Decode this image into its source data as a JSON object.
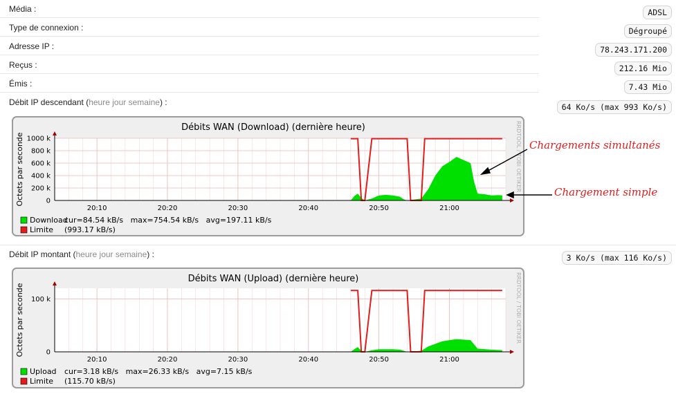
{
  "info": {
    "media_label": "Média :",
    "media_value": "ADSL",
    "type_label": "Type de connexion :",
    "type_value": "Dégroupé",
    "ip_label": "Adresse IP :",
    "ip_value": "78.243.171.200",
    "recus_label": "Reçus :",
    "recus_value": "212.16 Mio",
    "emis_label": "Émis :",
    "emis_value": "7.43 Mio"
  },
  "down": {
    "label_pre": "Débit IP descendant (",
    "link_heure": "heure",
    "link_jour": "jour",
    "link_semaine": "semaine",
    "label_post": ") :",
    "value": "64 Ko/s (max 993 Ko/s)"
  },
  "up": {
    "label_pre": "Débit IP montant (",
    "link_heure": "heure",
    "link_jour": "jour",
    "link_semaine": "semaine",
    "label_post": ") :",
    "value": "3 Ko/s (max 116 Ko/s)"
  },
  "annotations": {
    "simultanes": "Chargements simultanés",
    "simple": "Chargement simple"
  },
  "chart_data": [
    {
      "type": "area",
      "title": "Débits WAN (Download)  (dernière heure)",
      "ylabel": "Octets par seconde",
      "watermark": "RRDTOOL / TOBI OETIKER",
      "x_ticks": [
        "20:10",
        "20:20",
        "20:30",
        "20:40",
        "20:50",
        "21:00"
      ],
      "y_ticks": [
        "1000 k",
        "800 k",
        "600 k",
        "400 k",
        "200 k",
        "0"
      ],
      "ylim": [
        0,
        1000000
      ],
      "series": [
        {
          "name": "Download",
          "color": "#00e000",
          "legend_stats": "cur=84.54 kB/s   max=754.54 kB/s   avg=197.11 kB/s",
          "x": [
            "20:46",
            "20:46:30",
            "20:47",
            "20:47:30",
            "20:48",
            "20:49",
            "20:50",
            "20:51",
            "20:52",
            "20:53",
            "20:53:30",
            "20:54",
            "20:56",
            "20:57",
            "20:58",
            "20:59",
            "21:00",
            "21:01",
            "21:02",
            "21:03",
            "21:03:30",
            "21:04",
            "21:05",
            "21:06",
            "21:07",
            "21:07:30"
          ],
          "values": [
            0,
            70000,
            110000,
            40000,
            0,
            30000,
            80000,
            90000,
            80000,
            60000,
            20000,
            0,
            30000,
            180000,
            400000,
            550000,
            620000,
            700000,
            650000,
            600000,
            300000,
            110000,
            100000,
            80000,
            85000,
            80000
          ]
        },
        {
          "name": "Limite",
          "color": "#e31b1b",
          "legend_stats": "(993.17 kB/s)",
          "x": [
            "20:46",
            "20:47",
            "20:47:30",
            "20:48",
            "20:49",
            "20:49:30",
            "20:54",
            "20:54:30",
            "20:56",
            "20:56:30",
            "21:07:30"
          ],
          "values": [
            993170,
            993170,
            0,
            0,
            993170,
            993170,
            993170,
            0,
            0,
            993170,
            993170
          ]
        }
      ]
    },
    {
      "type": "area",
      "title": "Débits WAN (Upload)  (dernière heure)",
      "ylabel": "Octets par seconde",
      "watermark": "RRDTOOL / TOBI OETIKER",
      "x_ticks": [
        "20:10",
        "20:20",
        "20:30",
        "20:40",
        "20:50",
        "21:00"
      ],
      "y_ticks": [
        "100 k",
        "0"
      ],
      "ylim": [
        0,
        120000
      ],
      "series": [
        {
          "name": "Upload",
          "color": "#00e000",
          "legend_stats": "cur=3.18 kB/s   max=26.33 kB/s   avg=7.15 kB/s",
          "x": [
            "20:46",
            "20:46:30",
            "20:47",
            "20:47:30",
            "20:48",
            "20:49",
            "20:50",
            "20:52",
            "20:53",
            "20:54",
            "20:56",
            "20:57",
            "20:58",
            "20:59",
            "21:00",
            "21:01",
            "21:02",
            "21:03",
            "21:04",
            "21:06",
            "21:07:30"
          ],
          "values": [
            0,
            5000,
            9000,
            2000,
            0,
            3000,
            5000,
            5000,
            4000,
            0,
            2000,
            10000,
            15000,
            20000,
            22000,
            24000,
            23000,
            22000,
            6000,
            4000,
            3180
          ]
        },
        {
          "name": "Limite",
          "color": "#e31b1b",
          "legend_stats": "(115.70 kB/s)",
          "x": [
            "20:46",
            "20:47",
            "20:47:30",
            "20:48",
            "20:49",
            "20:49:30",
            "20:54",
            "20:54:30",
            "20:56",
            "20:56:30",
            "21:07:30"
          ],
          "values": [
            115700,
            115700,
            0,
            0,
            115700,
            115700,
            115700,
            0,
            0,
            115700,
            115700
          ]
        }
      ]
    }
  ]
}
